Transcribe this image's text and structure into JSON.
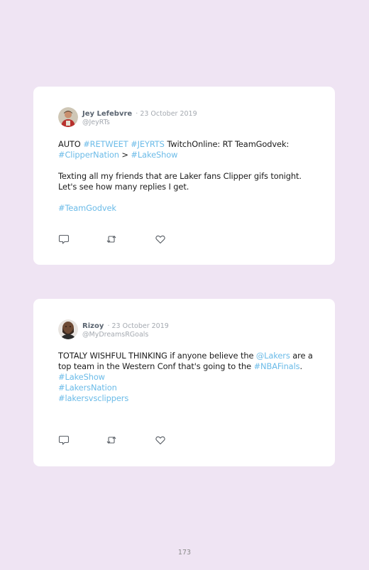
{
  "tweets": [
    {
      "name": "Jey Lefebvre",
      "date": "· 23 October 2019",
      "handle": "@JeyRTs",
      "p1": {
        "a": "AUTO ",
        "b": "#RETWEET",
        "c": " ",
        "d": "#JEYRTS",
        "e": " TwitchOnline: RT TeamGodvek: ",
        "f": "#ClipperNation",
        "g": " > ",
        "h": "#LakeShow"
      },
      "p2": "Texting all my friends that are Laker fans Clipper gifs tonight. Let's see how many replies I get.",
      "p3": "#TeamGodvek"
    },
    {
      "name": "Rizoy",
      "date": "· 23 October 2019",
      "handle": "@MyDreamsRGoals",
      "p1": {
        "a": "TOTALY WISHFUL THINKING if anyone believe the ",
        "b": "@Lakers",
        "c": " are a top team in the Western Conf that's going to the ",
        "d": "#NBAFinals",
        "e": "."
      },
      "tags": [
        "#LakeShow",
        "#LakersNation",
        "#lakersvsclippers"
      ]
    }
  ],
  "icons": {
    "reply": "reply-icon",
    "retweet": "retweet-icon",
    "like": "like-icon"
  },
  "colors": {
    "background": "#efe4f3",
    "card": "#ffffff",
    "link": "#6bbbe8",
    "text": "#1b1b1b",
    "muted": "#a4a9b0"
  },
  "page_number": "173"
}
